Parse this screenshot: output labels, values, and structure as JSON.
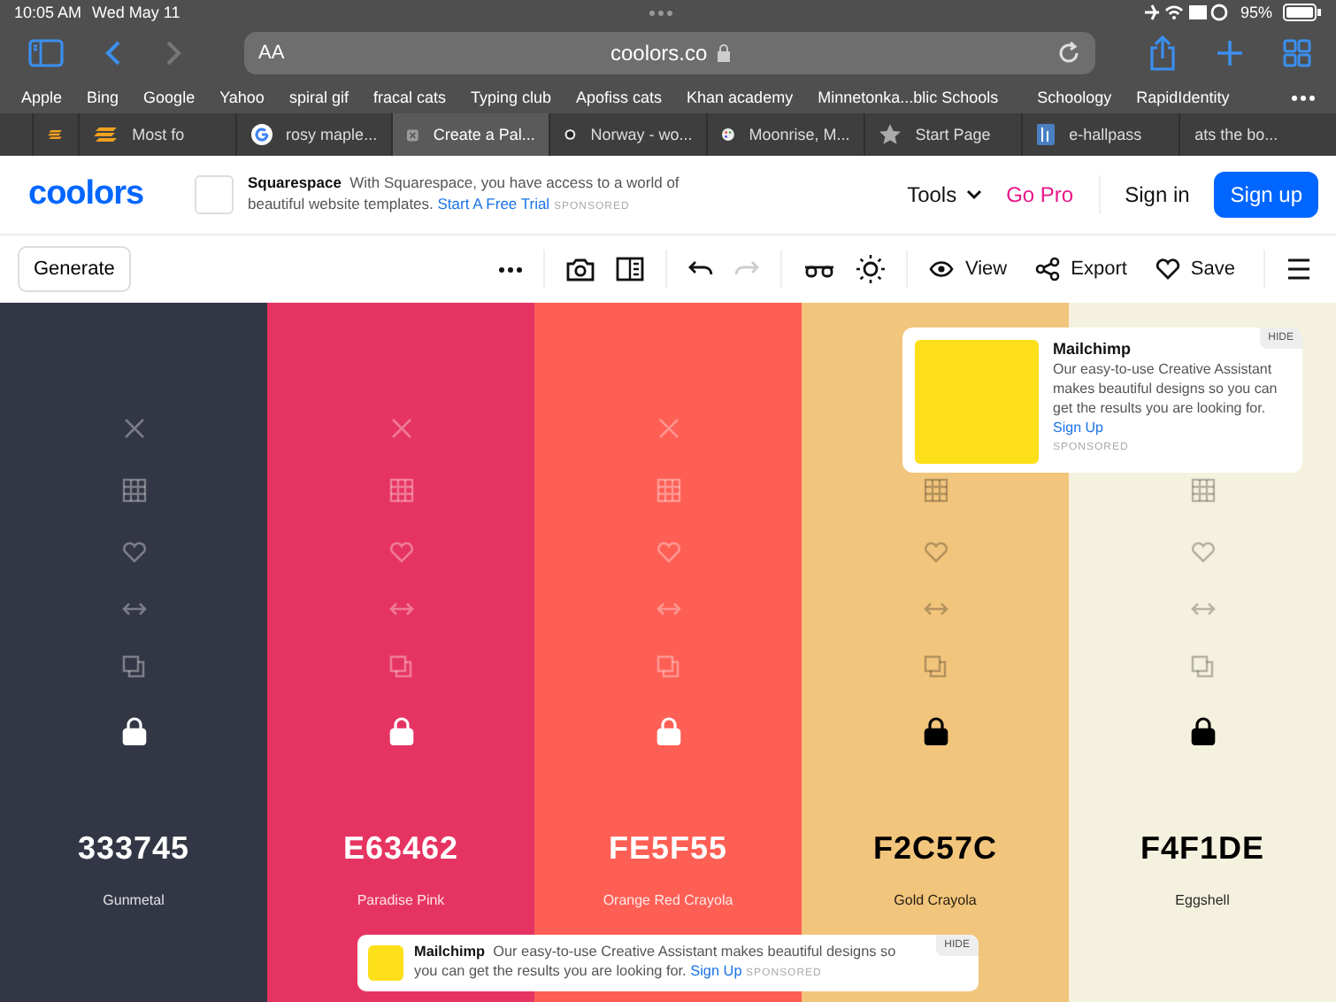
{
  "status_bar": {
    "time": "10:05 AM",
    "date": "Wed May 11",
    "battery": "95%"
  },
  "browser": {
    "address": "coolors.co",
    "text_size": "AA"
  },
  "bookmarks": [
    "Apple",
    "Bing",
    "Google",
    "Yahoo",
    "spiral gif",
    "fracal cats",
    "Typing club",
    "Apofiss cats",
    "Khan academy",
    "Minnetonka...blic Schools",
    "Schoology",
    "RapidIdentity"
  ],
  "tabs": [
    {
      "selected": false
    },
    {
      "title": "Most fo",
      "selected": false
    },
    {
      "title": "rosy maple...",
      "selected": false
    },
    {
      "title": "Create a Pal...",
      "selected": true
    },
    {
      "title": "Norway - wo...",
      "selected": false
    },
    {
      "title": "Moonrise, M...",
      "selected": false
    },
    {
      "title": "Start Page",
      "selected": false
    },
    {
      "title": "e-hallpass",
      "selected": false
    },
    {
      "title": "ats the bo...",
      "selected": false
    }
  ],
  "header": {
    "logo": "coolors",
    "ad": {
      "brand": "Squarespace",
      "text": "With Squarespace, you have access to a world of beautiful website templates.",
      "link": "Start A Free Trial",
      "sponsored": "SPONSORED"
    },
    "nav": [
      "Tools",
      "Go Pro",
      "Sign in"
    ],
    "signup": "Sign up"
  },
  "toolbar": {
    "generate": "Generate",
    "redo_disabled": true,
    "actions": [
      "View",
      "Export",
      "Save"
    ]
  },
  "palette": [
    {
      "hex": "333745",
      "name": "Gunmetal",
      "color": "#333745",
      "locked": true
    },
    {
      "hex": "E63462",
      "name": "Paradise Pink",
      "color": "#e63462",
      "locked": true
    },
    {
      "hex": "FE5F55",
      "name": "Orange Red Crayola",
      "color": "#fe5f55",
      "locked": true
    },
    {
      "hex": "F2C57C",
      "name": "Gold Crayola",
      "color": "#f2c57c",
      "locked": true
    },
    {
      "hex": "F4F1DE",
      "name": "Eggshell",
      "color": "#f4f1de",
      "locked": true
    }
  ],
  "side_ad": {
    "brand": "Mailchimp",
    "text": "Our easy-to-use Creative Assistant makes beautiful designs so you can get the results you are looking for.",
    "link": "Sign Up",
    "sponsored": "SPONSORED",
    "hide": "HIDE"
  },
  "bottom_ad": {
    "brand": "Mailchimp",
    "text": "Our easy-to-use Creative Assistant makes beautiful designs so you can get the results you are looking for.",
    "link": "Sign Up",
    "sponsored": "SPONSORED",
    "hide": "HIDE"
  }
}
